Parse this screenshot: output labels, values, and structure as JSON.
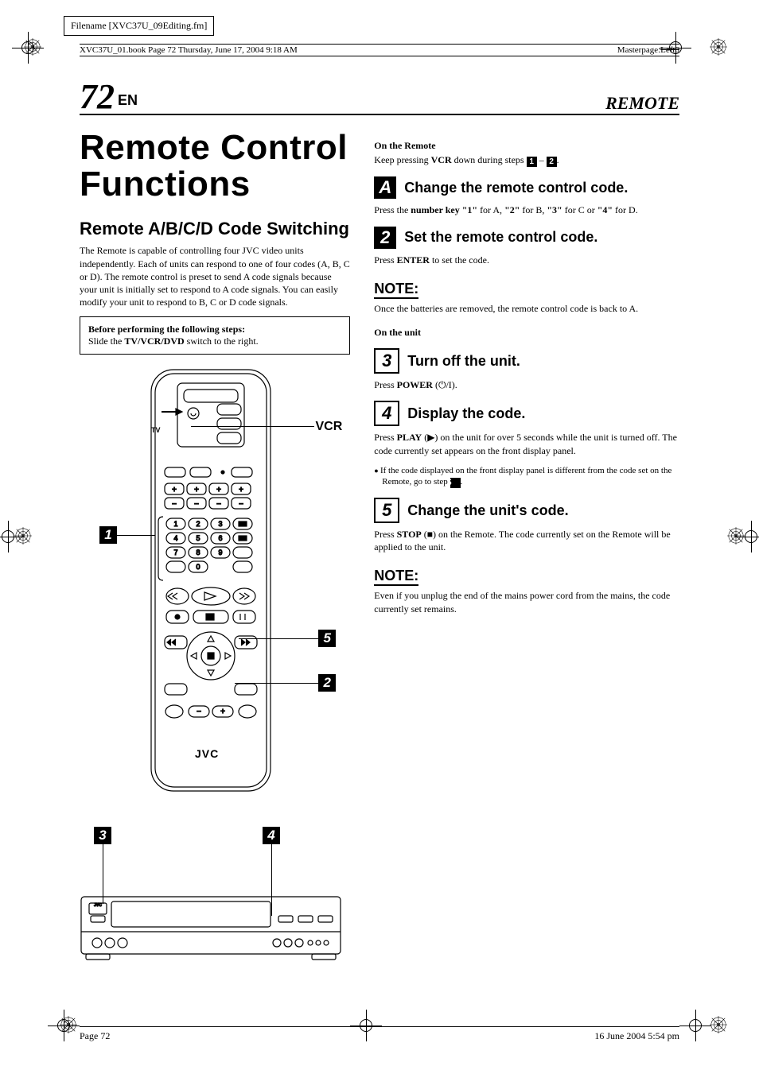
{
  "filename": "Filename [XVC37U_09Editing.fm]",
  "book_stamp": "XVC37U_01.book  Page 72  Thursday, June 17, 2004  9:18 AM",
  "masterpage_label": "Masterpage:",
  "masterpage_value": "Left0",
  "page_number": "72",
  "page_lang": "EN",
  "section": "REMOTE",
  "title": "Remote Control Functions",
  "subsection": "Remote A/B/C/D Code Switching",
  "intro": "The Remote is capable of controlling four JVC video units independently. Each of units can respond to one of four codes (A, B, C or D). The remote control is preset to send A code signals because your unit is initially set to respond to A code signals. You can easily modify your unit to respond to B, C or D code signals.",
  "box_heading": "Before performing the following steps:",
  "box_text_1": "Slide the ",
  "box_text_2": "TV/VCR/DVD",
  "box_text_3": " switch to the right.",
  "diagram": {
    "vcr_label": "VCR",
    "tv_label": "TV",
    "brand": "JVC",
    "callouts": {
      "c1": "1",
      "c2": "2",
      "c3": "3",
      "c4": "4",
      "c5": "5"
    }
  },
  "right": {
    "on_remote": "On the Remote",
    "keep_pressing_1": "Keep pressing ",
    "keep_pressing_vcr": "VCR",
    "keep_pressing_2": " down during steps ",
    "keep_pressing_dash": " – ",
    "keep_pressing_end": ".",
    "step_a_num": "A",
    "step_a_title": "Change the remote control code.",
    "step_a_text_1": "Press the ",
    "step_a_text_2": "number key \"1\"",
    "step_a_text_3": " for A, ",
    "step_a_text_4": "\"2\"",
    "step_a_text_5": " for B, ",
    "step_a_text_6": "\"3\"",
    "step_a_text_7": " for C or ",
    "step_a_text_8": "\"4\"",
    "step_a_text_9": " for D.",
    "step_b_num": "2",
    "step_b_title": "Set the remote control code.",
    "step_b_text_1": "Press ",
    "step_b_text_2": "ENTER",
    "step_b_text_3": " to set the code.",
    "note1_hd": "NOTE:",
    "note1_text": "Once the batteries are removed, the remote control code is back to A.",
    "on_unit": "On the unit",
    "step_3_num": "3",
    "step_3_title": "Turn off the unit.",
    "step_3_text_1": "Press ",
    "step_3_text_2": "POWER",
    "step_3_text_3": " (⏻/I).",
    "step_4_num": "4",
    "step_4_title": "Display the code.",
    "step_4_text_1": "Press ",
    "step_4_text_2": "PLAY",
    "step_4_text_3": " (▶) on the unit for over 5 seconds while the unit is turned off. The code currently set appears on the front display panel.",
    "step_4_bullet": "If the code displayed on the front display panel is different from the code set on the Remote, go to step ",
    "step_4_bullet_end": ".",
    "step_5_num": "5",
    "step_5_title": "Change the unit's code.",
    "step_5_text_1": "Press ",
    "step_5_text_2": "STOP",
    "step_5_text_3": " (■) on the Remote. The code currently set on the Remote will be applied to the unit.",
    "note2_hd": "NOTE:",
    "note2_text": "Even if you unplug the end of the mains power cord from the mains, the code currently set remains."
  },
  "footer_left": "Page 72",
  "footer_right": "16 June 2004 5:54 pm"
}
